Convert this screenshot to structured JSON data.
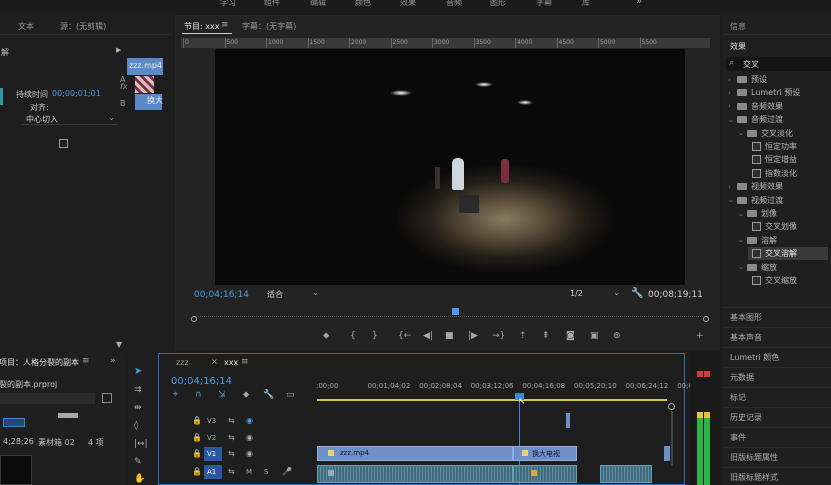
{
  "top_menu": [
    "学习",
    "组件",
    "编辑",
    "颜色",
    "效果",
    "音频",
    "图形",
    "字幕",
    "库"
  ],
  "top_more": "»",
  "source_panel": {
    "tabs": [
      "文本",
      "源：(无剪辑)"
    ],
    "left_label": "解",
    "duration_label": "持续时间",
    "duration_value": "00;00;01;01",
    "align_label": "对齐:",
    "align_value": "中心切入",
    "clip_name": "zzz.mp4",
    "clip_short": "换大",
    "side_labels": [
      "A",
      "B"
    ],
    "fx": "fx"
  },
  "program": {
    "tab_label": "节目: xxx",
    "caption_tab": "字幕：(无字幕)",
    "ruler_ticks": [
      "0",
      "500",
      "1000",
      "1500",
      "2000",
      "2500",
      "3000",
      "3500",
      "4000",
      "4500",
      "5000",
      "5500"
    ],
    "timecode": "00;04;16;14",
    "fit": "适合",
    "resolution": "1/2",
    "duration": "00;08;19;11"
  },
  "project": {
    "title": "项目：人格分裂的副本",
    "file": "裂的副本.prproj",
    "item_meta": "素材箱 02",
    "item_count": "4 项",
    "item_time": "4;28;26"
  },
  "timeline": {
    "tabs": [
      "zzz",
      "xxx"
    ],
    "timecode": "00;04;16;14",
    "ruler_labels": [
      ":00;00",
      "00;01;04;02",
      "00;02;08;04",
      "00;03;12;06",
      "00;04;16;08",
      "00;05;20;10",
      "00;06;24;12",
      "00;0"
    ],
    "tracks": [
      {
        "name": "V3",
        "type": "video"
      },
      {
        "name": "V2",
        "type": "video"
      },
      {
        "name": "V1",
        "type": "video",
        "target": "V1"
      },
      {
        "name": "A1",
        "type": "audio",
        "target": "A1",
        "m": "M",
        "s": "S"
      }
    ],
    "clips": {
      "v1_a": "zzz.mp4",
      "v1_b": "换大电视"
    }
  },
  "effects_panel": {
    "info_tab": "信息",
    "effects_tab": "效果",
    "search_value": "交叉",
    "tree": [
      {
        "label": "预设",
        "depth": 0,
        "kind": "folder",
        "open": false
      },
      {
        "label": "Lumetri 预设",
        "depth": 0,
        "kind": "folder",
        "open": false
      },
      {
        "label": "音频效果",
        "depth": 0,
        "kind": "folder",
        "open": false
      },
      {
        "label": "音频过渡",
        "depth": 0,
        "kind": "folder",
        "open": true
      },
      {
        "label": "交叉淡化",
        "depth": 1,
        "kind": "folder",
        "open": true
      },
      {
        "label": "恒定功率",
        "depth": 2,
        "kind": "fx"
      },
      {
        "label": "恒定增益",
        "depth": 2,
        "kind": "fx"
      },
      {
        "label": "指数淡化",
        "depth": 2,
        "kind": "fx"
      },
      {
        "label": "视频效果",
        "depth": 0,
        "kind": "folder",
        "open": false
      },
      {
        "label": "视频过渡",
        "depth": 0,
        "kind": "folder",
        "open": true
      },
      {
        "label": "划像",
        "depth": 1,
        "kind": "folder",
        "open": true
      },
      {
        "label": "交叉划像",
        "depth": 2,
        "kind": "fx"
      },
      {
        "label": "溶解",
        "depth": 1,
        "kind": "folder",
        "open": true
      },
      {
        "label": "交叉溶解",
        "depth": 2,
        "kind": "fx",
        "selected": true
      },
      {
        "label": "缩放",
        "depth": 1,
        "kind": "folder",
        "open": true
      },
      {
        "label": "交叉缩放",
        "depth": 2,
        "kind": "fx"
      }
    ],
    "bottom_panels": [
      "基本图形",
      "基本声音",
      "Lumetri 颜色",
      "元数据",
      "标记",
      "历史记录",
      "事件",
      "旧版标题属性",
      "旧版标题样式"
    ]
  },
  "colors": {
    "accent_blue": "#4c9bea",
    "video_clip": "#6f8fc9",
    "audio_clip": "#3f6d7f",
    "playhead": "#3d86d8",
    "work_area": "#d8c83a",
    "meter_green": "#2eb34a"
  }
}
